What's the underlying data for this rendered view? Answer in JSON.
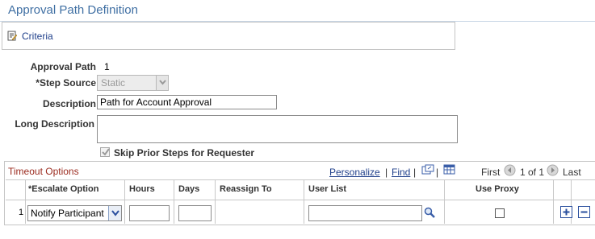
{
  "page": {
    "title": "Approval Path Definition"
  },
  "criteria": {
    "link_label": "Criteria",
    "icon": "document-edit-icon"
  },
  "form": {
    "approval_path": {
      "label": "Approval Path",
      "value": "1"
    },
    "step_source": {
      "label": "*Step Source",
      "value": "Static"
    },
    "description": {
      "label": "Description",
      "value": "Path for Account Approval"
    },
    "long_description": {
      "label": "Long Description",
      "value": ""
    },
    "skip_prior": {
      "label": "Skip Prior Steps for Requester",
      "checked": true
    }
  },
  "grid": {
    "title": "Timeout Options",
    "nav": {
      "personalize": "Personalize",
      "separator1": "|",
      "find": "Find",
      "separator2": "|",
      "first": "First",
      "range": "1 of 1",
      "last": "Last",
      "icons": [
        "view-all-icon",
        "spreadsheet-icon",
        "prev-icon",
        "next-icon"
      ]
    },
    "columns": [
      "*Escalate Option",
      "Hours",
      "Days",
      "Reassign To",
      "User List",
      "Use Proxy"
    ],
    "rows": [
      {
        "row_num": "1",
        "escalate_option": "Notify Participant",
        "hours": "",
        "days": "",
        "reassign_to": "",
        "user_list": "",
        "use_proxy": false
      }
    ]
  }
}
